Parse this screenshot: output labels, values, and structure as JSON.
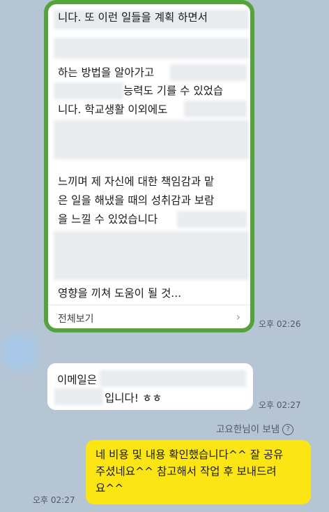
{
  "messages": [
    {
      "lines": [
        "니다. 또 이런 일들을 계획 하면서",
        "하는 방법을 알아가고",
        "능력도 기를 수 있었습",
        "니다. 학교생활 이외에도",
        "느끼며 제 자신에 대한 책임감과 맡",
        "은 일을 해냈을 때의 성취감과 보람",
        "을 느낄 수 있었습니다",
        "영향을 끼쳐 도움이 될 것..."
      ],
      "view_all": "전체보기",
      "time": "오후 02:26"
    },
    {
      "lines": [
        "이메일은",
        "입니다! ㅎㅎ"
      ],
      "time": "오후 02:27"
    },
    {
      "sender_label": "고요한님이 보냄",
      "lines": [
        "네 비용 및 내용 확인했습니다^^ 잘 공유",
        "주셨네요^^ 참고해서 작업 후 보내드려",
        "요^^"
      ],
      "time": "오후 02:27"
    }
  ],
  "colors": {
    "background": "#b6c5d4",
    "highlight_border": "#56a33c",
    "my_bubble": "#fce514"
  }
}
